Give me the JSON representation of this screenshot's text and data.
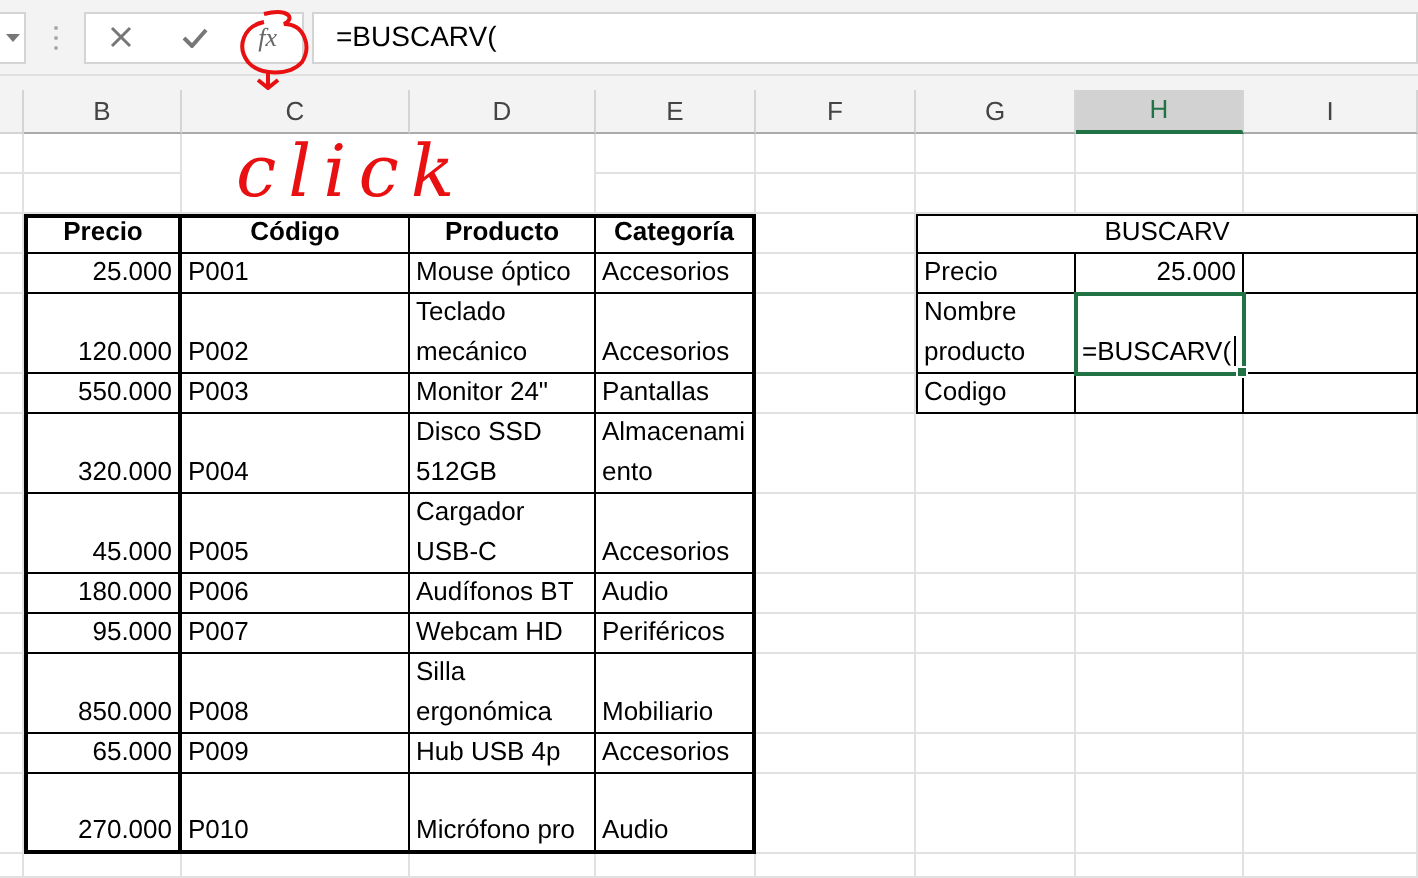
{
  "formula_bar": {
    "function_button": "fx",
    "value": "=BUSCARV("
  },
  "columns": [
    {
      "label": "B",
      "selected": false
    },
    {
      "label": "C",
      "selected": false
    },
    {
      "label": "D",
      "selected": false
    },
    {
      "label": "E",
      "selected": false
    },
    {
      "label": "F",
      "selected": false
    },
    {
      "label": "G",
      "selected": false
    },
    {
      "label": "H",
      "selected": true
    },
    {
      "label": "I",
      "selected": false
    }
  ],
  "products_table": {
    "columns": [
      "Precio",
      "Código",
      "Producto",
      "Categoría"
    ],
    "rows": [
      [
        "25.000",
        "P001",
        "Mouse óptico",
        "Accesorios"
      ],
      [
        "120.000",
        "P002",
        "Teclado mecánico",
        "Accesorios"
      ],
      [
        "550.000",
        "P003",
        "Monitor 24\"",
        "Pantallas"
      ],
      [
        "320.000",
        "P004",
        "Disco SSD 512GB",
        "Almacenamiento"
      ],
      [
        "45.000",
        "P005",
        "Cargador USB-C",
        "Accesorios"
      ],
      [
        "180.000",
        "P006",
        "Audífonos BT",
        "Audio"
      ],
      [
        "95.000",
        "P007",
        "Webcam HD",
        "Periféricos"
      ],
      [
        "850.000",
        "P008",
        "Silla ergonómica",
        "Mobiliario"
      ],
      [
        "65.000",
        "P009",
        "Hub USB 4p",
        "Accesorios"
      ],
      [
        "270.000",
        "P010",
        "Micrófono pro",
        "Audio"
      ]
    ]
  },
  "lookup_table": {
    "title": "BUSCARV",
    "rows": [
      {
        "label": "Precio",
        "value": "25.000",
        "selected": false
      },
      {
        "label": "Nombre producto",
        "value": "=BUSCARV(",
        "selected": true
      },
      {
        "label": "Codigo",
        "value": "",
        "selected": false
      }
    ]
  },
  "annotation": {
    "text": "click"
  }
}
